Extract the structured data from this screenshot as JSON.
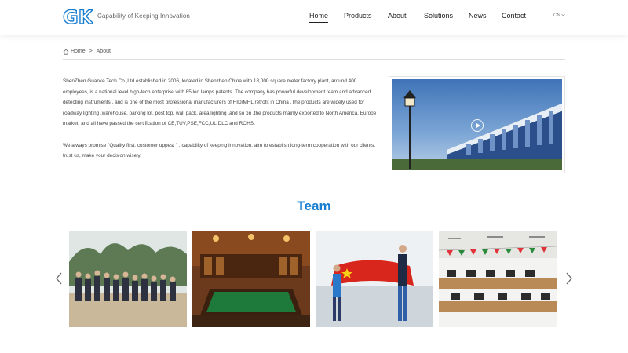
{
  "header": {
    "logo_text": "GK",
    "tagline": "Capability of Keeping Innovation",
    "nav": [
      {
        "label": "Home",
        "active": true
      },
      {
        "label": "Products",
        "active": false
      },
      {
        "label": "About",
        "active": false
      },
      {
        "label": "Solutions",
        "active": false
      },
      {
        "label": "News",
        "active": false
      },
      {
        "label": "Contact",
        "active": false
      }
    ],
    "lang": "CN",
    "brand_color": "#1a7fd1"
  },
  "breadcrumb": {
    "home": "Home",
    "separator": ">",
    "current": "About"
  },
  "intro": {
    "paragraph1": "ShenZhen Guanke Tech Co.,Ltd established in 2006, located in Shenzhen,China with 18,000 square meter factory plant, around 400 employees, is a national level high-tech enterprise with 85 led lamps patents .The company has powerful development team and advanced detecting instruments , and is one of the most professional manufacturers of HID/MHL retrofit in China .The products are widely used for roadway lighting ,warehouse, parking lot, post top, wall pack, area lighting ,and so on ,the products mainly exported to North America, Europe market, and all have passed the certification of CE,TUV,PSE,FCC,UL,DLC and ROHS.",
    "paragraph2": "We always promise \"Quality first, customer uppest \" , capability of keeping innovation, aim to establish long-term cooperation with our clients, trust us, make your decision wisely."
  },
  "team": {
    "title": "Team",
    "photos": [
      "group-outdoor-photo",
      "billiards-room-photo",
      "flag-team-photo",
      "office-photo"
    ]
  }
}
